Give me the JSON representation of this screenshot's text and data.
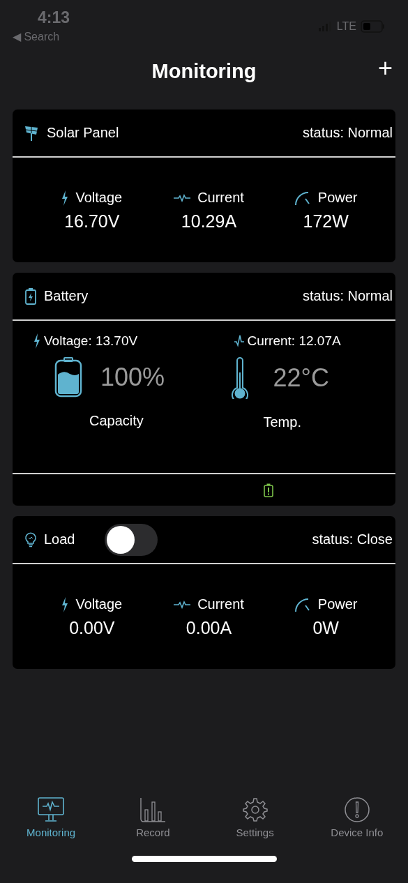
{
  "status_bar": {
    "time": "4:13",
    "back": "◀ Search",
    "network": "LTE"
  },
  "header": {
    "title": "Monitoring",
    "add": "+"
  },
  "solar": {
    "title": "Solar Panel",
    "status": "status: Normal",
    "metrics": [
      {
        "kind": "voltage",
        "label": "Voltage",
        "value": "16.70V"
      },
      {
        "kind": "current",
        "label": "Current",
        "value": "10.29A"
      },
      {
        "kind": "power",
        "label": "Power",
        "value": "172W"
      }
    ]
  },
  "battery": {
    "title": "Battery",
    "status": "status: Normal",
    "voltage": "Voltage: 13.70V",
    "current": "Current: 12.07A",
    "capacity": "100%",
    "capacity_label": "Capacity",
    "temp": "22°C",
    "temp_label": "Temp."
  },
  "load": {
    "title": "Load",
    "on": false,
    "status": "status: Close",
    "metrics": [
      {
        "kind": "voltage",
        "label": "Voltage",
        "value": "0.00V"
      },
      {
        "kind": "current",
        "label": "Current",
        "value": "0.00A"
      },
      {
        "kind": "power",
        "label": "Power",
        "value": "0W"
      }
    ]
  },
  "tabs": [
    {
      "kind": "monitor",
      "label": "Monitoring",
      "selected": true
    },
    {
      "kind": "record",
      "label": "Record",
      "selected": false
    },
    {
      "kind": "settings",
      "label": "Settings",
      "selected": false
    },
    {
      "kind": "info",
      "label": "Device Info",
      "selected": false
    }
  ]
}
